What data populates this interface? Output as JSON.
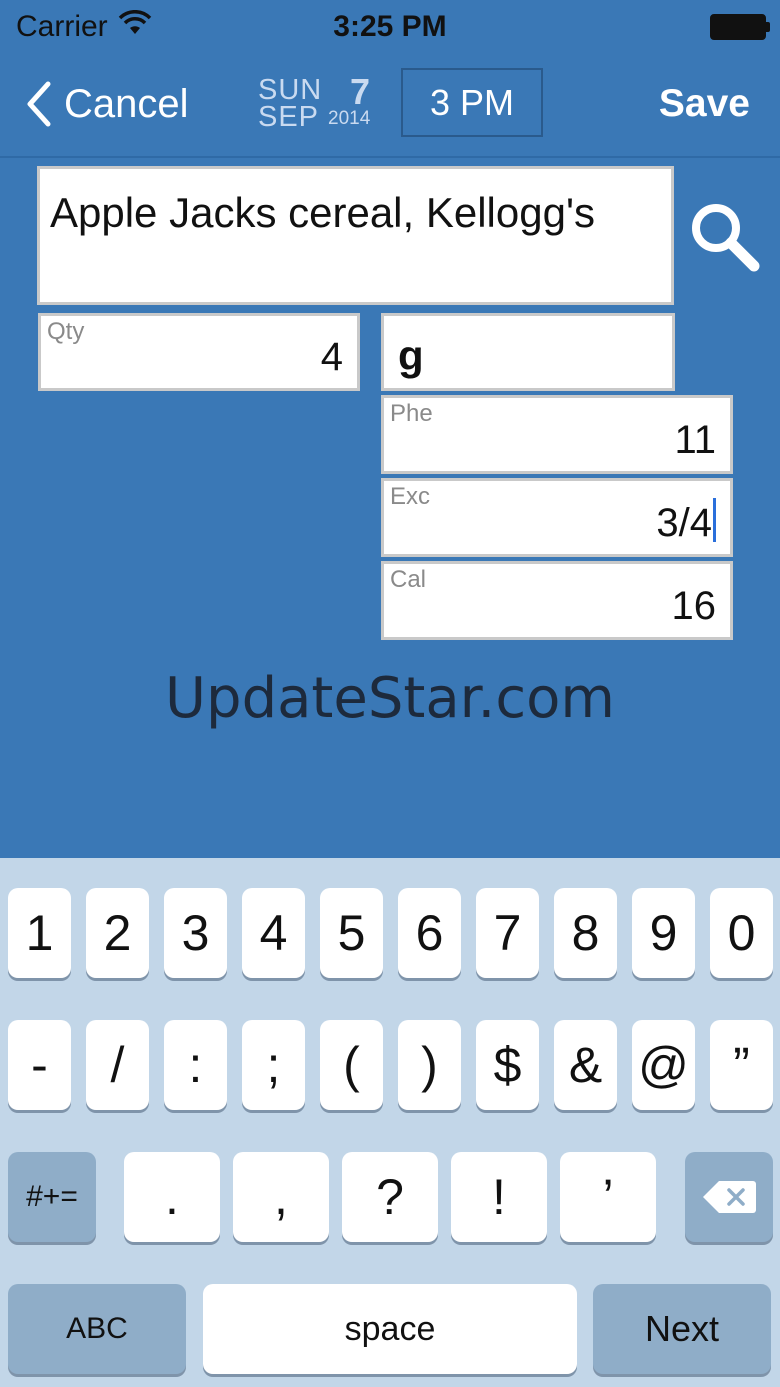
{
  "status_bar": {
    "carrier": "Carrier",
    "time": "3:25 PM"
  },
  "nav": {
    "cancel_label": "Cancel",
    "date": {
      "dow": "SUN",
      "month": "SEP",
      "day": "7",
      "year": "2014"
    },
    "time_label": "3 PM",
    "save_label": "Save"
  },
  "form": {
    "food_name": "Apple Jacks cereal, Kellogg's",
    "qty": {
      "label": "Qty",
      "value": "4"
    },
    "unit": {
      "value": "g"
    },
    "phe": {
      "label": "Phe",
      "value": "11"
    },
    "exc": {
      "label": "Exc",
      "value": "3/4"
    },
    "cal": {
      "label": "Cal",
      "value": "16"
    }
  },
  "watermark": "UpdateStar.com",
  "keyboard": {
    "row1": [
      "1",
      "2",
      "3",
      "4",
      "5",
      "6",
      "7",
      "8",
      "9",
      "0"
    ],
    "row2": [
      "-",
      "/",
      ":",
      ";",
      "(",
      ")",
      "$",
      "&",
      "@",
      "”"
    ],
    "row3": {
      "mode_key": "#+=",
      "keys": [
        ".",
        ",",
        "?",
        "!",
        "’"
      ]
    },
    "row4": {
      "abc": "ABC",
      "space": "space",
      "next": "Next"
    }
  },
  "colors": {
    "background": "#3a78b6",
    "keyboard": "#c2d6e8",
    "cursor": "#2a6fdb"
  }
}
